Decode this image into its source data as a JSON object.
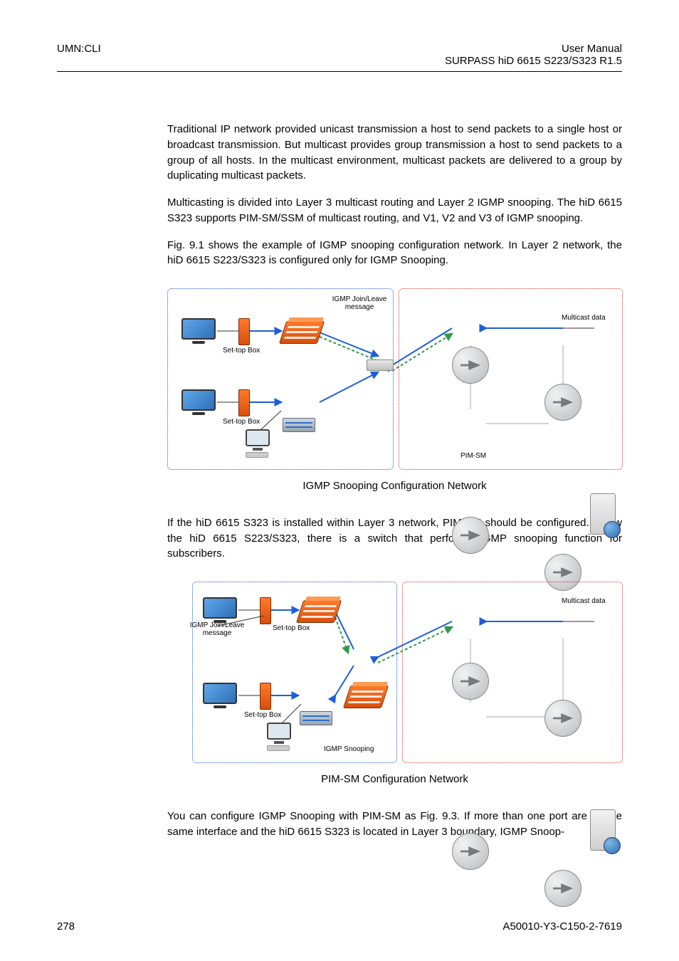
{
  "header": {
    "left": "UMN:CLI",
    "right_line1": "User Manual",
    "right_line2": "SURPASS hiD 6615 S223/S323 R1.5"
  },
  "body": {
    "p1": "Traditional IP network provided unicast transmission a host to send packets to a single host or broadcast transmission. But multicast provides group transmission a host to send packets to a group of all hosts. In the multicast environment, multicast packets are delivered to a group by duplicating multicast packets.",
    "p2": "Multicasting is divided into Layer 3 multicast routing and Layer 2 IGMP snooping. The hiD 6615 S323 supports PIM-SM/SSM of multicast routing, and V1, V2 and V3 of IGMP snooping.",
    "p3": "Fig. 9.1 shows the example of IGMP snooping configuration network. In Layer 2 network, the hiD 6615 S223/S323 is configured only for IGMP Snooping.",
    "p4": "If the hiD 6615 S323 is installed within Layer 3 network, PIM-SM should be configured. Below the hiD 6615 S223/S323, there is a switch that performs IGMP snooping function for subscribers.",
    "p5": "You can configure IGMP Snooping with PIM-SM as Fig. 9.3. If more than one port are on the same interface and the hiD 6615 S323 is located in Layer 3 boundary, IGMP Snoop-"
  },
  "fig1": {
    "caption": "IGMP Snooping Configuration Network",
    "labels": {
      "igmp_msg": "IGMP Join/Leave\nmessage",
      "stb": "Set-top Box",
      "pimsm": "PIM-SM",
      "multicast_data": "Multicast data"
    }
  },
  "fig2": {
    "caption": "PIM-SM Configuration Network",
    "labels": {
      "igmp_msg": "IGMP Join/Leave\nmessage",
      "stb": "Set-top Box",
      "igmp_snoop": "IGMP Snooping",
      "multicast_data": "Multicast data"
    }
  },
  "footer": {
    "page": "278",
    "docid": "A50010-Y3-C150-2-7619"
  }
}
